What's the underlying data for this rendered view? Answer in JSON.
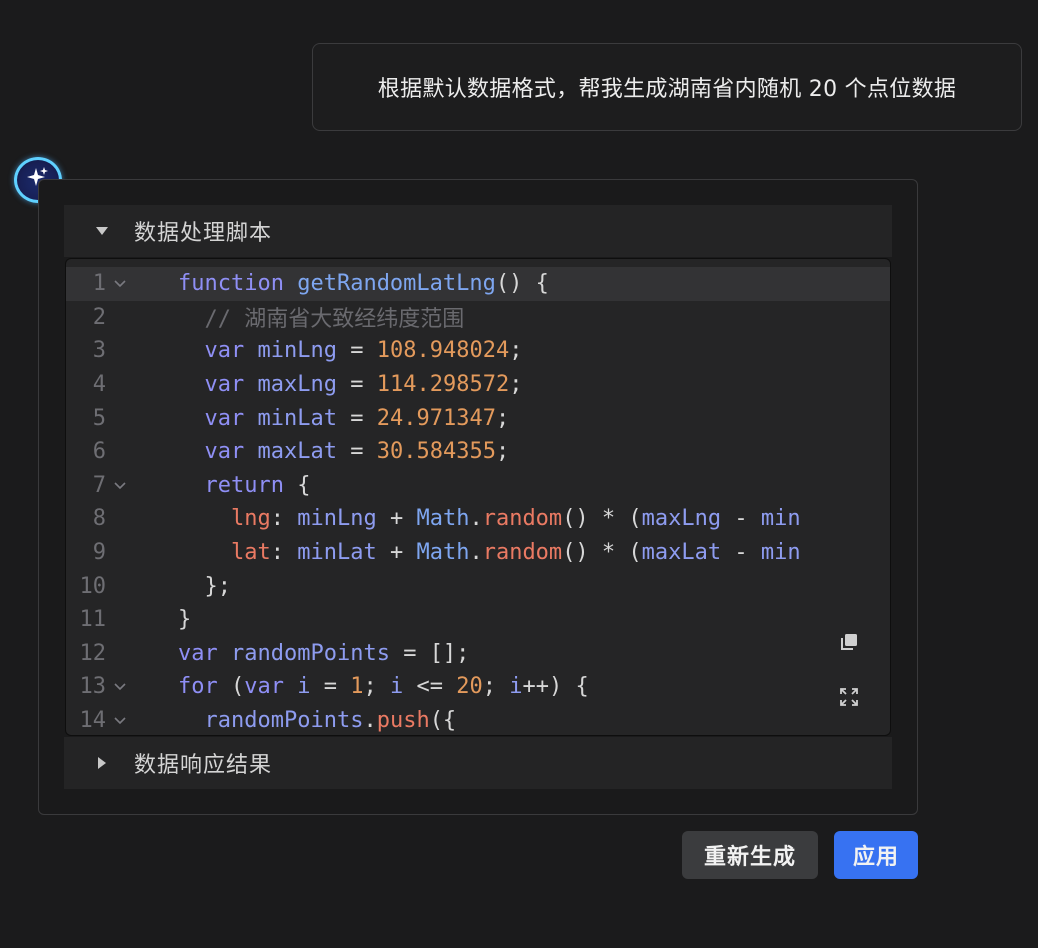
{
  "user_message": "根据默认数据格式，帮我生成湖南省内随机 20 个点位数据",
  "ai_avatar_icon": "sparkle-icon",
  "script_section": {
    "title": "数据处理脚本",
    "expanded": true
  },
  "result_section": {
    "title": "数据响应结果",
    "expanded": false
  },
  "code": {
    "line_numbers": [
      "1",
      "2",
      "3",
      "4",
      "5",
      "6",
      "7",
      "8",
      "9",
      "10",
      "11",
      "12",
      "13",
      "14"
    ],
    "lines": [
      [
        {
          "t": "function",
          "c": "kw"
        },
        {
          "t": " "
        },
        {
          "t": "getRandomLatLng",
          "c": "fn"
        },
        {
          "t": "() {"
        }
      ],
      [
        {
          "t": "  "
        },
        {
          "t": "// 湖南省大致经纬度范围",
          "c": "cm"
        }
      ],
      [
        {
          "t": "  "
        },
        {
          "t": "var",
          "c": "kw"
        },
        {
          "t": " "
        },
        {
          "t": "minLng",
          "c": "ident"
        },
        {
          "t": " = "
        },
        {
          "t": "108.948024",
          "c": "num"
        },
        {
          "t": ";"
        }
      ],
      [
        {
          "t": "  "
        },
        {
          "t": "var",
          "c": "kw"
        },
        {
          "t": " "
        },
        {
          "t": "maxLng",
          "c": "ident"
        },
        {
          "t": " = "
        },
        {
          "t": "114.298572",
          "c": "num"
        },
        {
          "t": ";"
        }
      ],
      [
        {
          "t": "  "
        },
        {
          "t": "var",
          "c": "kw"
        },
        {
          "t": " "
        },
        {
          "t": "minLat",
          "c": "ident"
        },
        {
          "t": " = "
        },
        {
          "t": "24.971347",
          "c": "num"
        },
        {
          "t": ";"
        }
      ],
      [
        {
          "t": "  "
        },
        {
          "t": "var",
          "c": "kw"
        },
        {
          "t": " "
        },
        {
          "t": "maxLat",
          "c": "ident"
        },
        {
          "t": " = "
        },
        {
          "t": "30.584355",
          "c": "num"
        },
        {
          "t": ";"
        }
      ],
      [
        {
          "t": "  "
        },
        {
          "t": "return",
          "c": "kw"
        },
        {
          "t": " {"
        }
      ],
      [
        {
          "t": "    "
        },
        {
          "t": "lng",
          "c": "prop"
        },
        {
          "t": ": "
        },
        {
          "t": "minLng",
          "c": "ident"
        },
        {
          "t": " + "
        },
        {
          "t": "Math",
          "c": "fn"
        },
        {
          "t": "."
        },
        {
          "t": "random",
          "c": "prop"
        },
        {
          "t": "() * ("
        },
        {
          "t": "maxLng",
          "c": "ident"
        },
        {
          "t": " - "
        },
        {
          "t": "min",
          "c": "ident"
        }
      ],
      [
        {
          "t": "    "
        },
        {
          "t": "lat",
          "c": "prop"
        },
        {
          "t": ": "
        },
        {
          "t": "minLat",
          "c": "ident"
        },
        {
          "t": " + "
        },
        {
          "t": "Math",
          "c": "fn"
        },
        {
          "t": "."
        },
        {
          "t": "random",
          "c": "prop"
        },
        {
          "t": "() * ("
        },
        {
          "t": "maxLat",
          "c": "ident"
        },
        {
          "t": " - "
        },
        {
          "t": "min",
          "c": "ident"
        }
      ],
      [
        {
          "t": "  };"
        }
      ],
      [
        {
          "t": "}"
        }
      ],
      [
        {
          "t": "var",
          "c": "kw"
        },
        {
          "t": " "
        },
        {
          "t": "randomPoints",
          "c": "ident"
        },
        {
          "t": " = [];"
        }
      ],
      [
        {
          "t": "for",
          "c": "kw"
        },
        {
          "t": " ("
        },
        {
          "t": "var",
          "c": "kw"
        },
        {
          "t": " "
        },
        {
          "t": "i",
          "c": "ident"
        },
        {
          "t": " = "
        },
        {
          "t": "1",
          "c": "num"
        },
        {
          "t": "; "
        },
        {
          "t": "i",
          "c": "ident"
        },
        {
          "t": " <= "
        },
        {
          "t": "20",
          "c": "num"
        },
        {
          "t": "; "
        },
        {
          "t": "i",
          "c": "ident"
        },
        {
          "t": "++) {"
        }
      ],
      [
        {
          "t": "  "
        },
        {
          "t": "randomPoints",
          "c": "ident"
        },
        {
          "t": "."
        },
        {
          "t": "push",
          "c": "prop"
        },
        {
          "t": "({"
        }
      ]
    ],
    "foldable_lines": [
      1,
      7,
      13,
      14
    ],
    "active_line": 1
  },
  "toolbar": {
    "copy_icon": "copy-icon",
    "expand_icon": "expand-icon"
  },
  "buttons": {
    "regenerate_label": "重新生成",
    "apply_label": "应用"
  },
  "colors": {
    "accent": "#3772f2",
    "avatar_ring": "#5fd0ff"
  }
}
